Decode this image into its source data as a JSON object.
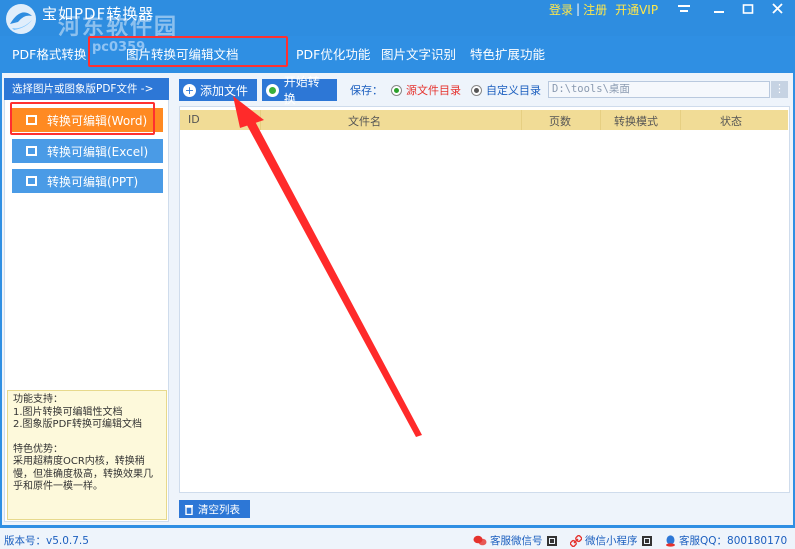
{
  "app": {
    "title": "宝如PDF转换器",
    "watermark": "河东软件园",
    "watermark_url": "pc0359"
  },
  "title_links": {
    "login": "登录",
    "separator": "|",
    "register": "注册",
    "vip": "开通VIP"
  },
  "window_controls": {
    "menu_icon": "hamburger-icon",
    "minimize_icon": "minimize-icon",
    "maximize_icon": "maximize-icon",
    "close_icon": "close-icon"
  },
  "tabs": [
    {
      "label": "PDF格式转换"
    },
    {
      "label": "图片转换可编辑文档"
    },
    {
      "label": "PDF优化功能"
    },
    {
      "label": "图片文字识别"
    },
    {
      "label": "特色扩展功能"
    }
  ],
  "left_panel": {
    "header": "选择图片或图象版PDF文件 ->",
    "buttons": [
      {
        "label": "转换可编辑(Word)",
        "active": true
      },
      {
        "label": "转换可编辑(Excel)",
        "active": false
      },
      {
        "label": "转换可编辑(PPT)",
        "active": false
      }
    ],
    "info": {
      "title": "功能支持：",
      "items": [
        "1.图片转换可编辑性文档",
        "2.图象版PDF转换可编辑文档"
      ],
      "feature_title": "特色优势：",
      "feature_text": "采用超精度OCR内核，转换稍慢，但准确度极高，转换效果几乎和原件一模一样。"
    }
  },
  "toolbar": {
    "add_file": "添加文件",
    "start_convert": "开始转换",
    "save_label": "保存：",
    "option_source": "源文件目录",
    "option_custom": "自定义目录",
    "path_value": "D:\\tools\\桌面",
    "browse": "⋮"
  },
  "table": {
    "columns": [
      "ID",
      "文件名",
      "页数",
      "转换模式",
      "状态"
    ],
    "rows": []
  },
  "clear_button": "清空列表",
  "status_bar": {
    "version": "版本号：v5.0.7.5",
    "wechat_service": "客服微信号",
    "mini_program": "微信小程序",
    "qq_service": "客服QQ：800180170"
  },
  "colors": {
    "primary": "#2e8de0",
    "accent_orange": "#ff8a22",
    "highlight_red": "#ff3030",
    "table_header": "#f1dc96"
  }
}
